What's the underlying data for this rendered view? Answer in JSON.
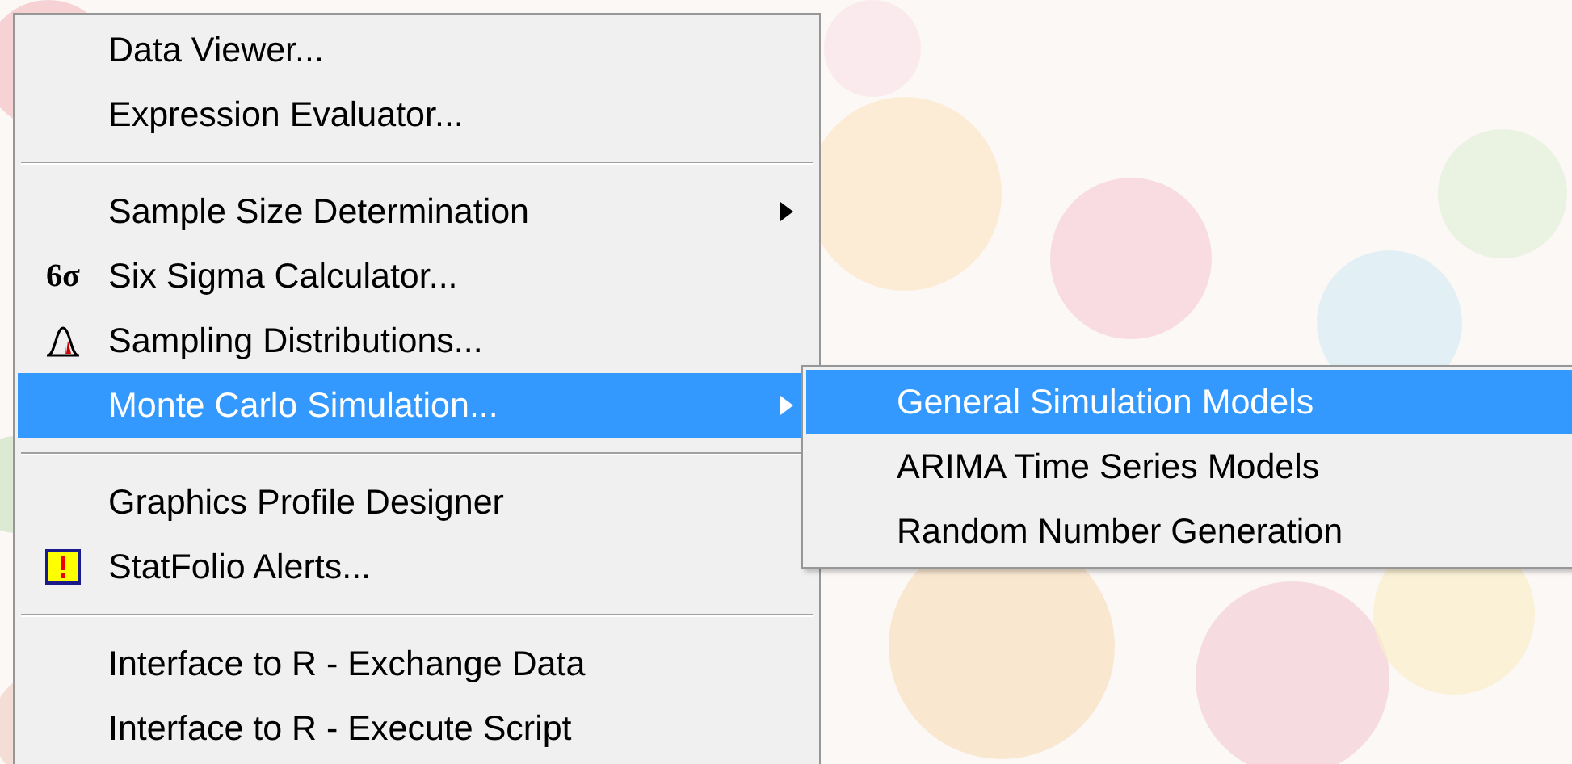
{
  "menu": {
    "items": [
      {
        "kind": "plain",
        "label": "Data Viewer...",
        "submenu": false,
        "selected": false
      },
      {
        "kind": "plain",
        "label": "Expression Evaluator...",
        "submenu": false,
        "selected": false
      },
      {
        "kind": "separator"
      },
      {
        "kind": "plain",
        "label": "Sample Size Determination",
        "submenu": true,
        "selected": false
      },
      {
        "kind": "glyph",
        "label": "Six Sigma Calculator...",
        "glyph": "6σ",
        "submenu": false,
        "selected": false
      },
      {
        "kind": "curve",
        "label": "Sampling Distributions...",
        "submenu": false,
        "selected": false
      },
      {
        "kind": "plain",
        "label": "Monte Carlo Simulation...",
        "submenu": true,
        "selected": true
      },
      {
        "kind": "separator"
      },
      {
        "kind": "plain",
        "label": "Graphics Profile Designer",
        "submenu": false,
        "selected": false
      },
      {
        "kind": "alert",
        "label": "StatFolio Alerts...",
        "submenu": false,
        "selected": false
      },
      {
        "kind": "separator"
      },
      {
        "kind": "plain",
        "label": "Interface to R - Exchange Data",
        "submenu": false,
        "selected": false
      },
      {
        "kind": "plain",
        "label": "Interface to R - Execute Script",
        "submenu": false,
        "selected": false
      }
    ]
  },
  "submenu": {
    "items": [
      {
        "label": "General Simulation Models",
        "selected": true
      },
      {
        "label": "ARIMA Time Series Models",
        "selected": false
      },
      {
        "label": "Random Number Generation",
        "selected": false
      }
    ]
  }
}
